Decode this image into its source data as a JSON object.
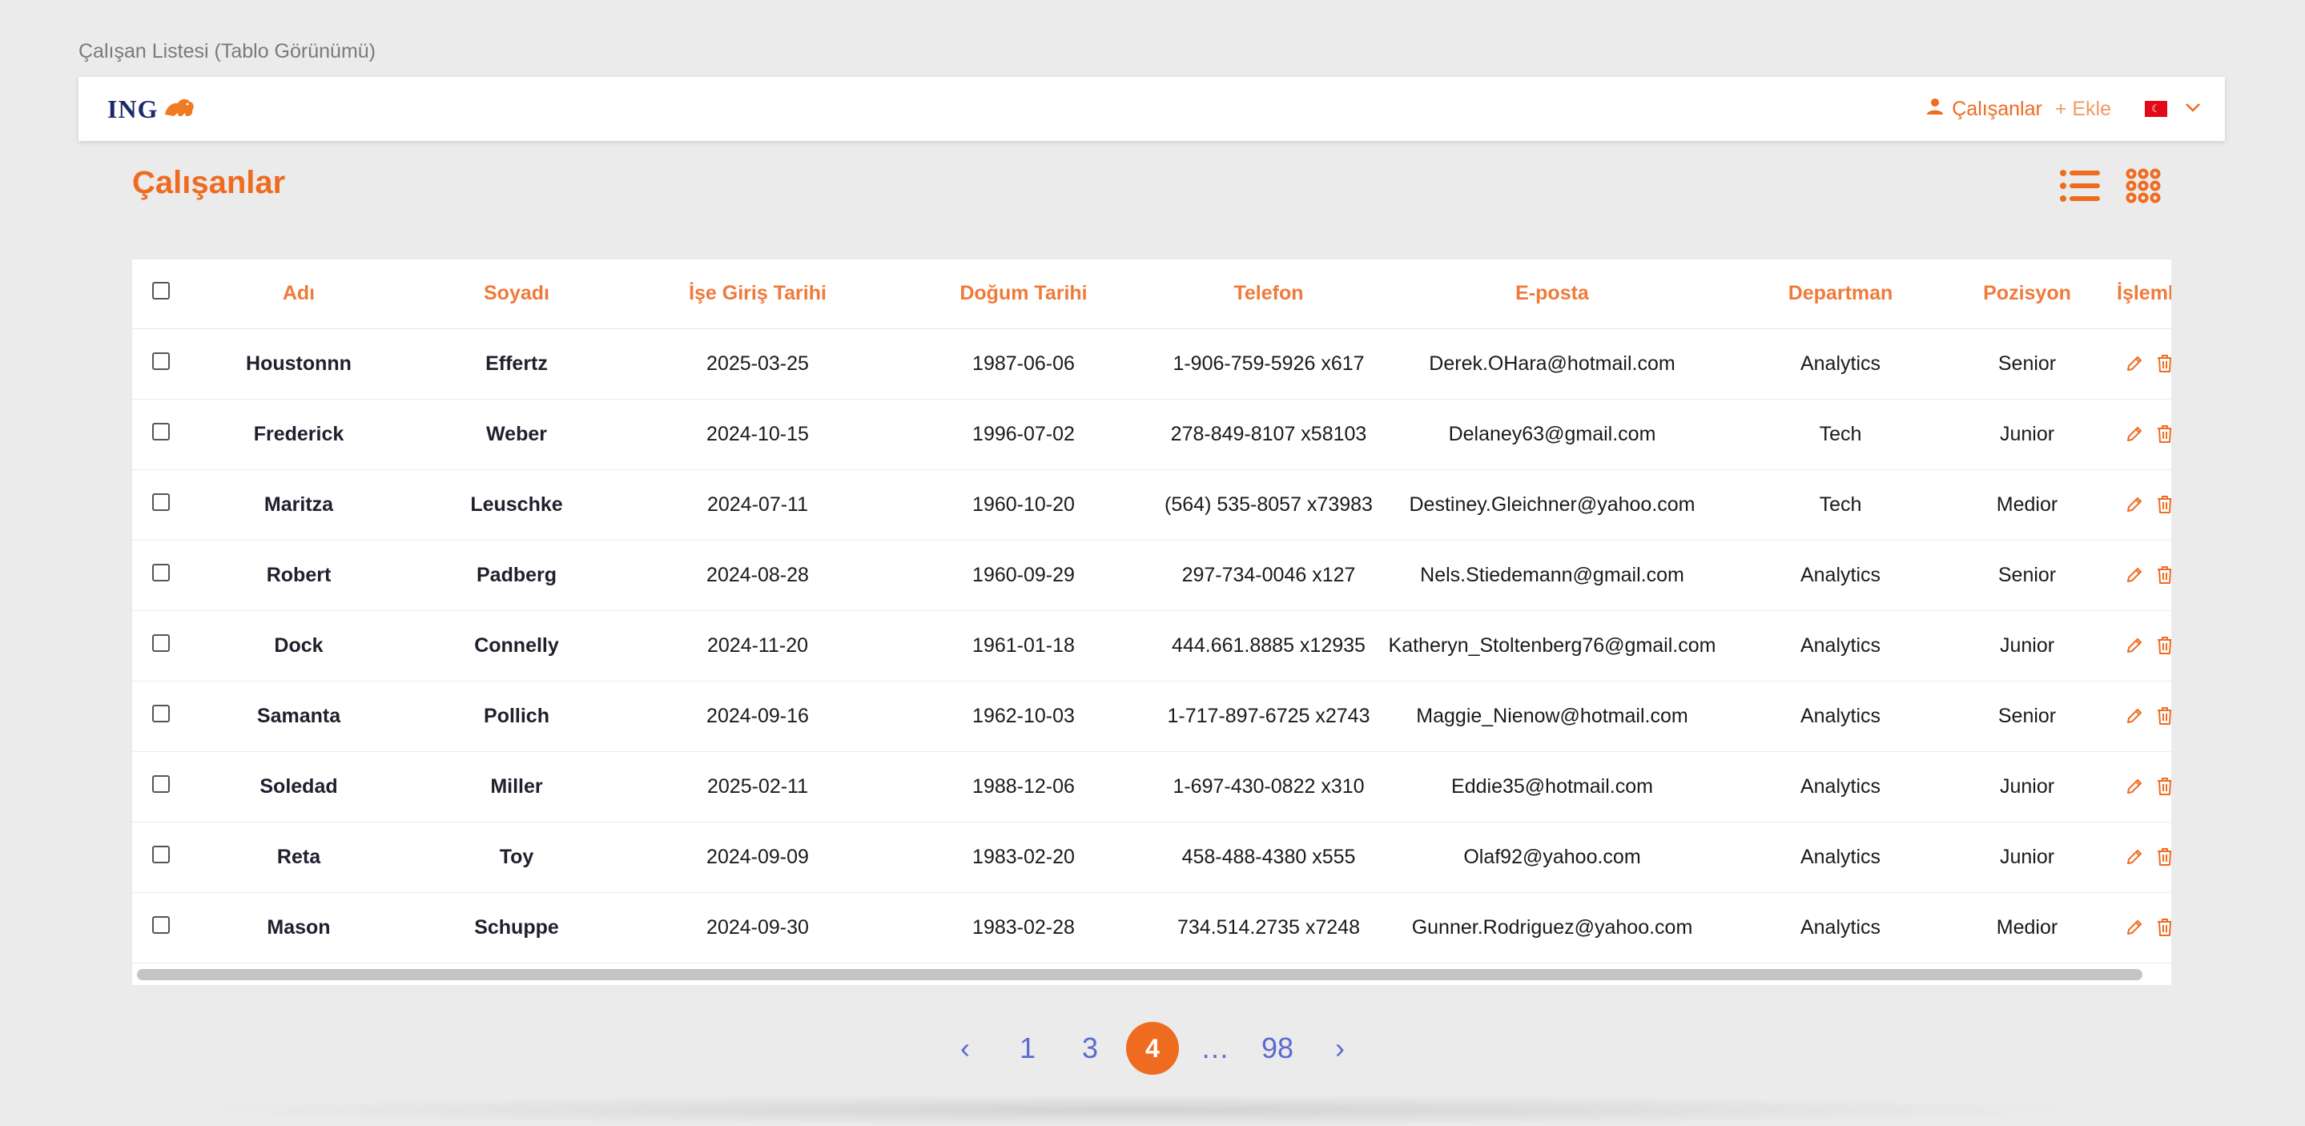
{
  "page_caption": "Çalışan Listesi (Tablo Görünümü)",
  "header": {
    "logo_text": "ING",
    "nav_employees": "Çalışanlar",
    "nav_add": "+ Ekle",
    "language_flag": "turkey-flag",
    "accent_color": "#ef6b20"
  },
  "title": "Çalışanlar",
  "table": {
    "columns": [
      "Adı",
      "Soyadı",
      "İşe Giriş Tarihi",
      "Doğum Tarihi",
      "Telefon",
      "E-posta",
      "Departman",
      "Pozisyon",
      "İşlemler"
    ],
    "rows": [
      {
        "first": "Houstonnn",
        "last": "Effertz",
        "hired": "2025-03-25",
        "birth": "1987-06-06",
        "phone": "1-906-759-5926 x617",
        "email": "Derek.OHara@hotmail.com",
        "dept": "Analytics",
        "position": "Senior"
      },
      {
        "first": "Frederick",
        "last": "Weber",
        "hired": "2024-10-15",
        "birth": "1996-07-02",
        "phone": "278-849-8107 x58103",
        "email": "Delaney63@gmail.com",
        "dept": "Tech",
        "position": "Junior"
      },
      {
        "first": "Maritza",
        "last": "Leuschke",
        "hired": "2024-07-11",
        "birth": "1960-10-20",
        "phone": "(564) 535-8057 x73983",
        "email": "Destiney.Gleichner@yahoo.com",
        "dept": "Tech",
        "position": "Medior"
      },
      {
        "first": "Robert",
        "last": "Padberg",
        "hired": "2024-08-28",
        "birth": "1960-09-29",
        "phone": "297-734-0046 x127",
        "email": "Nels.Stiedemann@gmail.com",
        "dept": "Analytics",
        "position": "Senior"
      },
      {
        "first": "Dock",
        "last": "Connelly",
        "hired": "2024-11-20",
        "birth": "1961-01-18",
        "phone": "444.661.8885 x12935",
        "email": "Katheryn_Stoltenberg76@gmail.com",
        "dept": "Analytics",
        "position": "Junior"
      },
      {
        "first": "Samanta",
        "last": "Pollich",
        "hired": "2024-09-16",
        "birth": "1962-10-03",
        "phone": "1-717-897-6725 x2743",
        "email": "Maggie_Nienow@hotmail.com",
        "dept": "Analytics",
        "position": "Senior"
      },
      {
        "first": "Soledad",
        "last": "Miller",
        "hired": "2025-02-11",
        "birth": "1988-12-06",
        "phone": "1-697-430-0822 x310",
        "email": "Eddie35@hotmail.com",
        "dept": "Analytics",
        "position": "Junior"
      },
      {
        "first": "Reta",
        "last": "Toy",
        "hired": "2024-09-09",
        "birth": "1983-02-20",
        "phone": "458-488-4380 x555",
        "email": "Olaf92@yahoo.com",
        "dept": "Analytics",
        "position": "Junior"
      },
      {
        "first": "Mason",
        "last": "Schuppe",
        "hired": "2024-09-30",
        "birth": "1983-02-28",
        "phone": "734.514.2735 x7248",
        "email": "Gunner.Rodriguez@yahoo.com",
        "dept": "Analytics",
        "position": "Medior"
      }
    ]
  },
  "pagination": {
    "prev": "‹",
    "pages": [
      "1",
      "3",
      "4",
      "…",
      "98"
    ],
    "current": "4",
    "next": "›"
  }
}
